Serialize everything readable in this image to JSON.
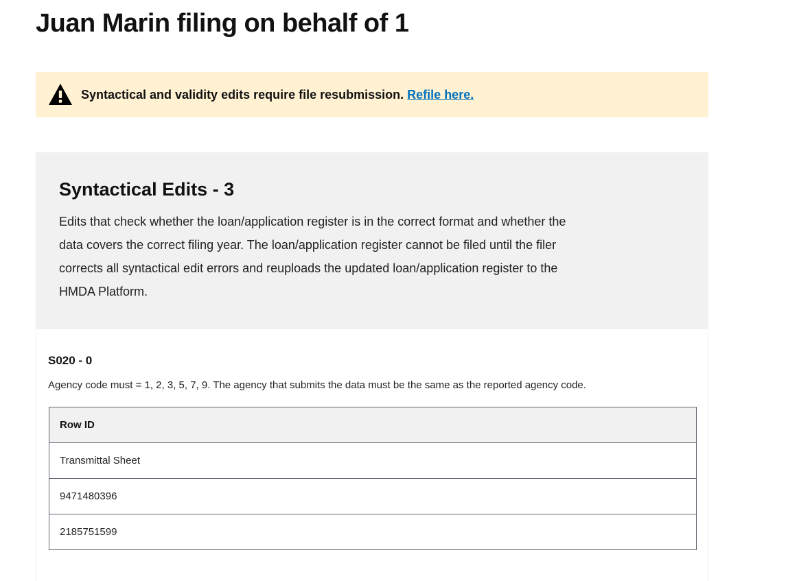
{
  "page": {
    "title": "Juan Marin filing on behalf of 1"
  },
  "alert": {
    "icon": "warning-icon",
    "message": "Syntactical and validity edits require file resubmission.",
    "link_text": "Refile here.",
    "background": "#fff1d2",
    "link_color": "#0071bc"
  },
  "syntactical_edits": {
    "title": "Syntactical Edits - 3",
    "description": "Edits that check whether the loan/application register is in the correct format and whether the data covers the correct filing year. The loan/application register cannot be filed until the filer corrects all syntactical edit errors and reuploads the updated loan/application register to the HMDA Platform.",
    "background": "#f1f1f1"
  },
  "edit": {
    "id": "S020 - 0",
    "description": "Agency code must = 1, 2, 3, 5, 7, 9. The agency that submits the data must be the same as the reported agency code.",
    "table": {
      "header": "Row ID",
      "rows": [
        "Transmittal Sheet",
        "9471480396",
        "2185751599"
      ]
    }
  }
}
